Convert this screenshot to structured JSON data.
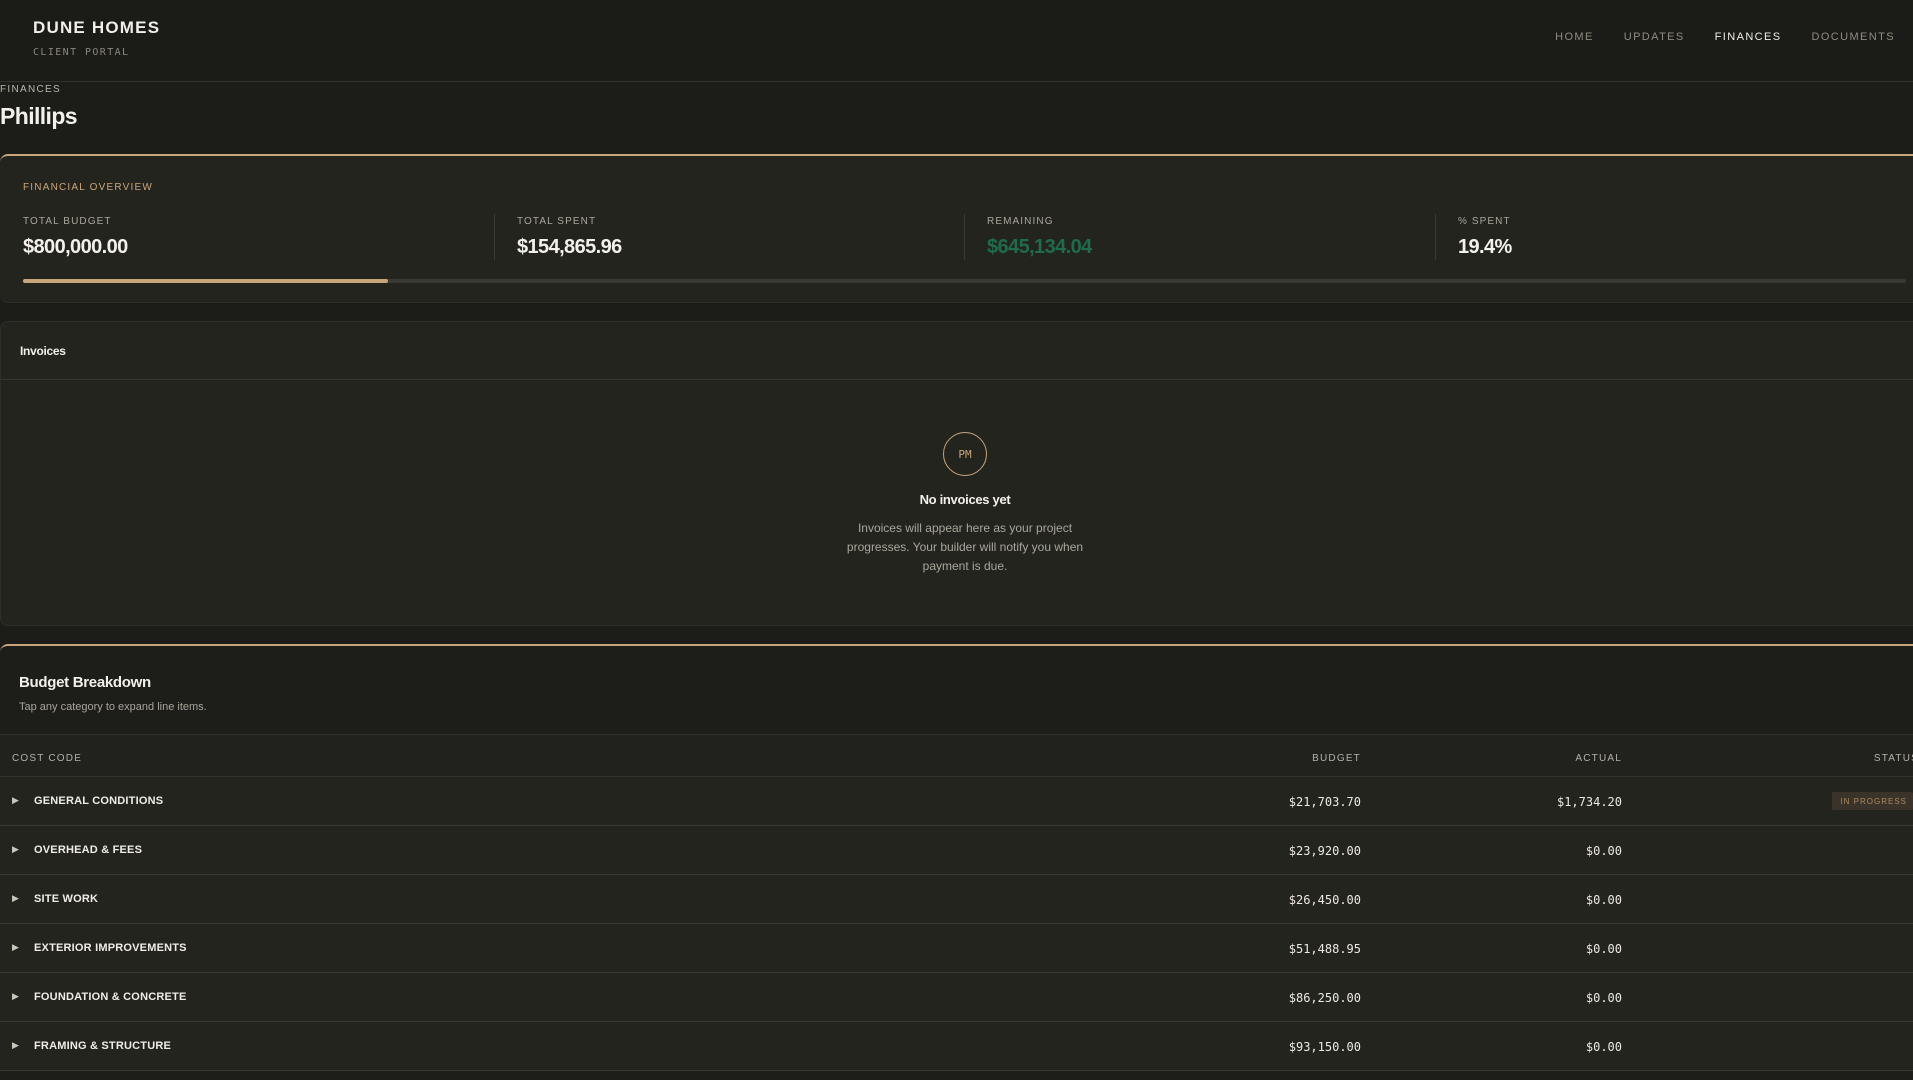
{
  "header": {
    "brand": "DUNE HOMES",
    "sub": "CLIENT PORTAL",
    "nav": [
      {
        "label": "HOME",
        "active": false
      },
      {
        "label": "UPDATES",
        "active": false
      },
      {
        "label": "FINANCES",
        "active": true
      },
      {
        "label": "DOCUMENTS",
        "active": false
      }
    ]
  },
  "page": {
    "breadcrumb": "FINANCES",
    "title": "Phillips"
  },
  "overview": {
    "label": "FINANCIAL OVERVIEW",
    "stats": [
      {
        "key": "TOTAL BUDGET",
        "value": "$800,000.00"
      },
      {
        "key": "TOTAL SPENT",
        "value": "$154,865.96"
      },
      {
        "key": "REMAINING",
        "value": "$645,134.04"
      },
      {
        "key": "% SPENT",
        "value": "19.4%"
      }
    ],
    "progress_fraction": 0.194,
    "accent": "#c8a57a",
    "remaining_color": "#1f6b4a"
  },
  "invoices": {
    "title": "Invoices",
    "badge": "PM",
    "empty_title": "No invoices yet",
    "empty_text": "Invoices will appear here as your project progresses. Your builder will notify you when payment is due."
  },
  "budget": {
    "title": "Budget Breakdown",
    "subtitle": "Tap any category to expand line items.",
    "columns": {
      "cost_code": "COST CODE",
      "budget": "BUDGET",
      "actual": "ACTUAL",
      "status": "STATUS"
    },
    "rows": [
      {
        "name": "GENERAL CONDITIONS",
        "budget": "$21,703.70",
        "actual": "$1,734.20",
        "status": "IN PROGRESS"
      },
      {
        "name": "OVERHEAD & FEES",
        "budget": "$23,920.00",
        "actual": "$0.00",
        "status": ""
      },
      {
        "name": "SITE WORK",
        "budget": "$26,450.00",
        "actual": "$0.00",
        "status": ""
      },
      {
        "name": "EXTERIOR IMPROVEMENTS",
        "budget": "$51,488.95",
        "actual": "$0.00",
        "status": ""
      },
      {
        "name": "FOUNDATION & CONCRETE",
        "budget": "$86,250.00",
        "actual": "$0.00",
        "status": ""
      },
      {
        "name": "FRAMING & STRUCTURE",
        "budget": "$93,150.00",
        "actual": "$0.00",
        "status": ""
      }
    ]
  }
}
